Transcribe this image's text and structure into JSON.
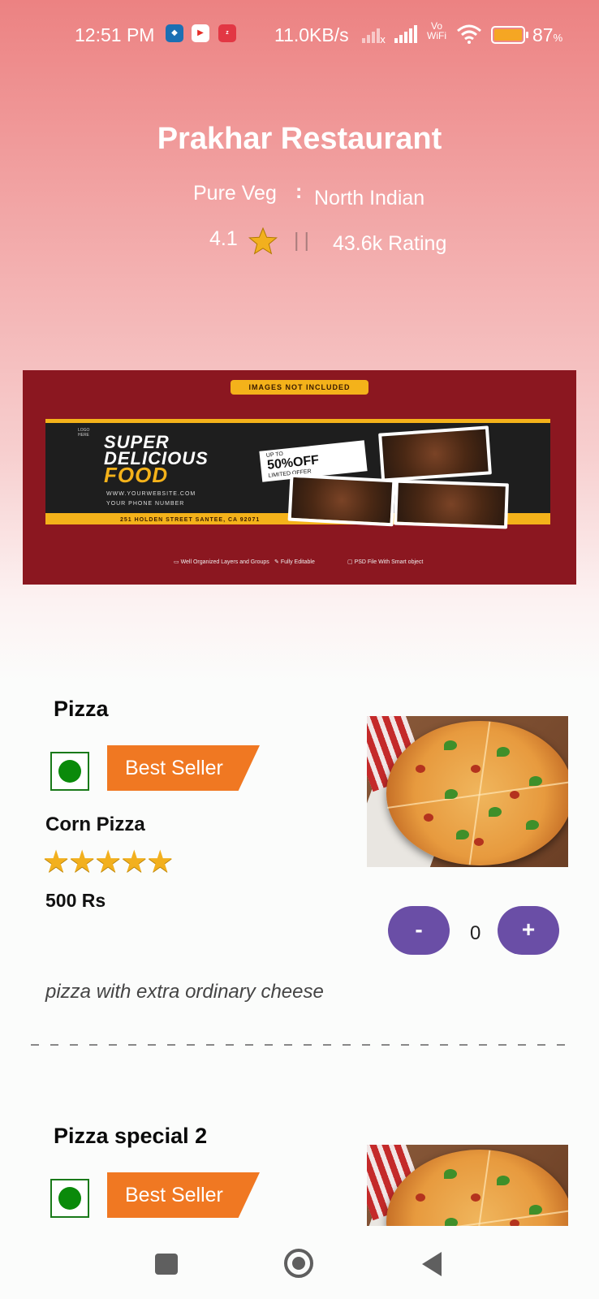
{
  "status_bar": {
    "time": "12:51 PM",
    "network_speed": "11.0KB/s",
    "vowifi_top": "Vo",
    "vowifi_bottom": "WiFi",
    "battery_percent": "87",
    "battery_suffix": "%",
    "battery_level": 0.87,
    "notification_icons": [
      "dominos-icon",
      "youtube-icon",
      "zomato-icon"
    ]
  },
  "restaurant": {
    "name": "Prakhar Restaurant",
    "type": "Pure Veg",
    "separator": ":",
    "cuisine": "North Indian",
    "rating": "4.1",
    "rating_divider": "||",
    "rating_count": "43.6k Rating"
  },
  "banner": {
    "notice": "IMAGES NOT INCLUDED",
    "logo_text_1": "LOGO",
    "logo_text_2": "HERE",
    "headline_1": "SUPER",
    "headline_2": "DELICIOUS",
    "headline_3": "FOOD",
    "offer_top": "UP TO",
    "offer_main": "50%OFF",
    "offer_bottom": "LIMITED OFFER",
    "website": "WWW.YOURWEBSITE.COM",
    "phone": "YOUR PHONE NUMBER",
    "address": "251 HOLDEN STREET SANTEE, CA 92071",
    "feature_1": "Well Organized Layers and Groups",
    "feature_2": "Fully Editable",
    "feature_3": "PSD File With Smart object"
  },
  "menu_items": [
    {
      "category": "Pizza",
      "badge": "Best Seller",
      "name": "Corn Pizza",
      "stars": 5,
      "stars_text": "★★★★★",
      "price": "500 Rs",
      "quantity": "0",
      "minus_label": "-",
      "plus_label": "+",
      "description": "pizza with extra ordinary cheese"
    },
    {
      "category": "Pizza special 2",
      "badge": "Best Seller"
    }
  ],
  "colors": {
    "header_gradient_top": "#EC8282",
    "badge_orange": "#F07822",
    "veg_green": "#0A8A0A",
    "qty_button_purple": "#6A4EA6",
    "star_gold": "#F2B01E"
  },
  "nav_bar": {
    "icons": [
      "recent-apps-icon",
      "home-icon",
      "back-icon"
    ]
  }
}
